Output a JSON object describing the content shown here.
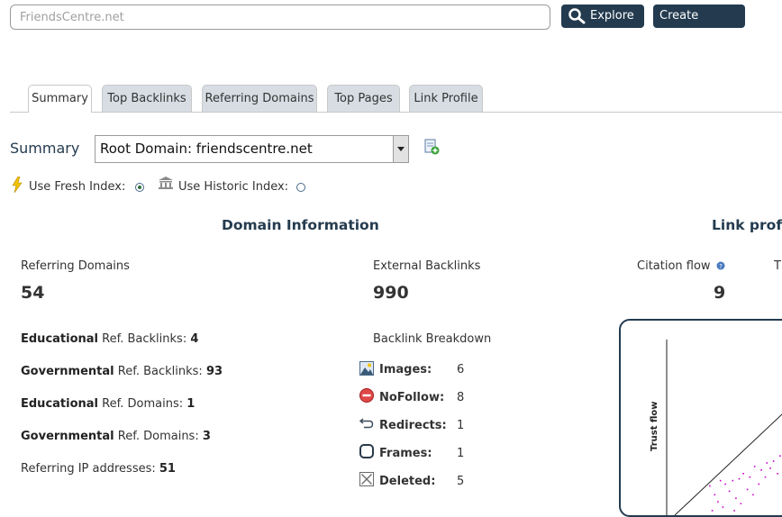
{
  "search": {
    "placeholder": "FriendsCentre.net"
  },
  "buttons": {
    "explore": "Explore",
    "create_report": "Create Report"
  },
  "tabs": [
    {
      "label": "Summary",
      "active": true
    },
    {
      "label": "Top Backlinks",
      "active": false
    },
    {
      "label": "Referring Domains",
      "active": false
    },
    {
      "label": "Top Pages",
      "active": false
    },
    {
      "label": "Link Profile",
      "active": false
    }
  ],
  "summary": {
    "title": "Summary",
    "selected_option": "Root Domain: friendscentre.net"
  },
  "index": {
    "fresh_label": "Use Fresh Index:",
    "historic_label": "Use Historic Index:",
    "selected": "fresh"
  },
  "domain_info": {
    "title": "Domain Information",
    "referring_domains_label": "Referring Domains",
    "referring_domains_value": "54",
    "external_backlinks_label": "External Backlinks",
    "external_backlinks_value": "990",
    "stats": [
      {
        "bold": "Educational",
        "label": "Ref. Backlinks:",
        "value": "4"
      },
      {
        "bold": "Governmental",
        "label": "Ref. Backlinks:",
        "value": "93"
      },
      {
        "bold": "Educational",
        "label": "Ref. Domains:",
        "value": "1"
      },
      {
        "bold": "Governmental",
        "label": "Ref. Domains:",
        "value": "3"
      },
      {
        "bold": "",
        "label": "Referring IP addresses:",
        "value": "51"
      }
    ],
    "breakdown_title": "Backlink Breakdown",
    "breakdown": [
      {
        "icon": "image-icon",
        "label": "Images:",
        "value": "6"
      },
      {
        "icon": "nofollow-icon",
        "label": "NoFollow:",
        "value": "8"
      },
      {
        "icon": "redirect-icon",
        "label": "Redirects:",
        "value": "1"
      },
      {
        "icon": "frame-icon",
        "label": "Frames:",
        "value": "1"
      },
      {
        "icon": "deleted-icon",
        "label": "Deleted:",
        "value": "5"
      }
    ]
  },
  "link_profile": {
    "title": "Link profil",
    "citation_flow_label": "Citation flow",
    "citation_flow_value": "9",
    "trust_flow_cut_label": "T",
    "chart_axis_label": "Trust flow"
  },
  "chart_data": {
    "type": "scatter",
    "ylabel": "Trust flow",
    "xlabel": "",
    "point_color": "#cc00cc",
    "points": [
      [
        0.42,
        0.83
      ],
      [
        0.55,
        0.8
      ],
      [
        0.61,
        0.82
      ],
      [
        0.7,
        0.8
      ],
      [
        0.78,
        0.79
      ],
      [
        0.83,
        0.76
      ],
      [
        0.91,
        0.78
      ],
      [
        0.97,
        0.72
      ],
      [
        1.05,
        0.74
      ],
      [
        1.12,
        0.7
      ],
      [
        1.2,
        0.69
      ],
      [
        1.28,
        0.66
      ],
      [
        0.48,
        0.88
      ],
      [
        0.66,
        0.86
      ],
      [
        0.74,
        0.9
      ],
      [
        0.88,
        0.85
      ],
      [
        0.52,
        0.92
      ],
      [
        0.95,
        0.88
      ],
      [
        1.02,
        0.82
      ],
      [
        1.1,
        0.78
      ],
      [
        1.16,
        0.73
      ],
      [
        1.32,
        0.63
      ],
      [
        0.58,
        0.95
      ],
      [
        0.8,
        0.93
      ],
      [
        1.4,
        0.6
      ],
      [
        0.45,
        0.97
      ],
      [
        0.72,
        0.97
      ],
      [
        1.25,
        0.76
      ]
    ]
  },
  "colors": {
    "brand_dark": "#243b4f",
    "tab_bg": "#d7dde3"
  }
}
